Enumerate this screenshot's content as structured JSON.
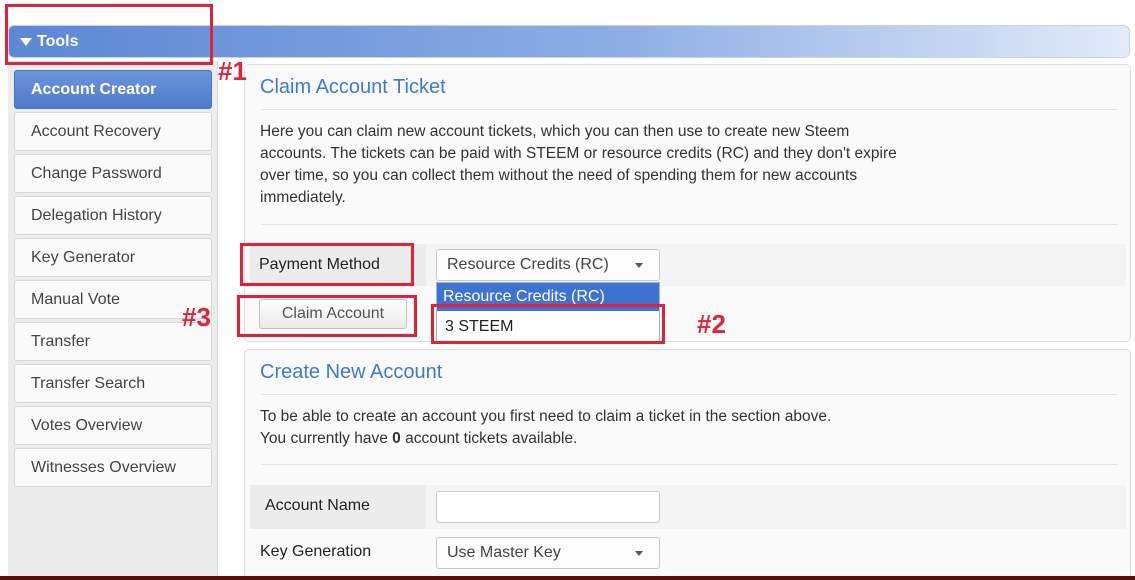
{
  "tools": {
    "title": "Tools"
  },
  "sidebar": {
    "items": [
      {
        "label": "Account Creator",
        "active": true
      },
      {
        "label": "Account Recovery"
      },
      {
        "label": "Change Password"
      },
      {
        "label": "Delegation History"
      },
      {
        "label": "Key Generator"
      },
      {
        "label": "Manual Vote"
      },
      {
        "label": "Transfer"
      },
      {
        "label": "Transfer Search"
      },
      {
        "label": "Votes Overview"
      },
      {
        "label": "Witnesses Overview"
      }
    ]
  },
  "claim": {
    "title": "Claim Account Ticket",
    "desc_lines": [
      "Here you can claim new account tickets, which you can then use to create new Steem",
      "accounts. The tickets can be paid with STEEM or resource credits (RC) and they don't expire",
      "over time, so you can collect them without the need of spending them for new accounts",
      "immediately."
    ],
    "payment_label": "Payment Method",
    "payment_selected": "Resource Credits (RC)",
    "payment_options": [
      "Resource Credits (RC)",
      "3 STEEM"
    ],
    "claim_button": "Claim Account"
  },
  "create": {
    "title": "Create New Account",
    "line1": "To be able to create an account you first need to claim a ticket in the section above.",
    "line2_prefix": "You currently have",
    "tickets_count": "0",
    "line2_suffix": "account tickets available.",
    "account_name_label": "Account Name",
    "account_name_value": "",
    "key_generation_label": "Key Generation",
    "key_generation_value": "Use Master Key"
  },
  "annotations": {
    "m1": "#1",
    "m2": "#2",
    "m3": "#3",
    "color": "#e0233b"
  },
  "colors": {
    "accent": "#3d7ad0",
    "active": "#4f7acb"
  }
}
